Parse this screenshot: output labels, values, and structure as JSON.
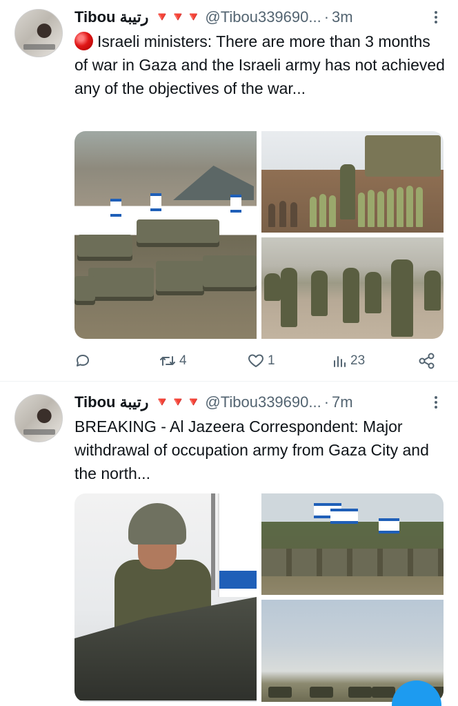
{
  "tweets": [
    {
      "author_name": "Tibou رتيبة",
      "hearts": "🔻🔻🔻",
      "handle": "@Tibou339690...",
      "separator": "·",
      "time": "3m",
      "text": "Israeli ministers: There are more than 3 months of war in Gaza and the Israeli army has not achieved any of the objectives of the war...",
      "stats": {
        "replies": "",
        "retweets": "4",
        "likes": "1",
        "views": "23"
      }
    },
    {
      "author_name": "Tibou رتيبة",
      "hearts": "🔻🔻🔻",
      "handle": "@Tibou339690...",
      "separator": "·",
      "time": "7m",
      "text": "BREAKING - Al Jazeera Correspondent: Major withdrawal of occupation army from Gaza City and the north..."
    }
  ],
  "icons": {
    "reply": "reply-icon",
    "retweet": "retweet-icon",
    "like": "heart-icon",
    "views": "views-chart-icon",
    "share": "share-icon",
    "more": "more-vertical-icon"
  },
  "colors": {
    "accent": "#1d9bf0",
    "muted": "#536471",
    "text": "#0f1419"
  }
}
